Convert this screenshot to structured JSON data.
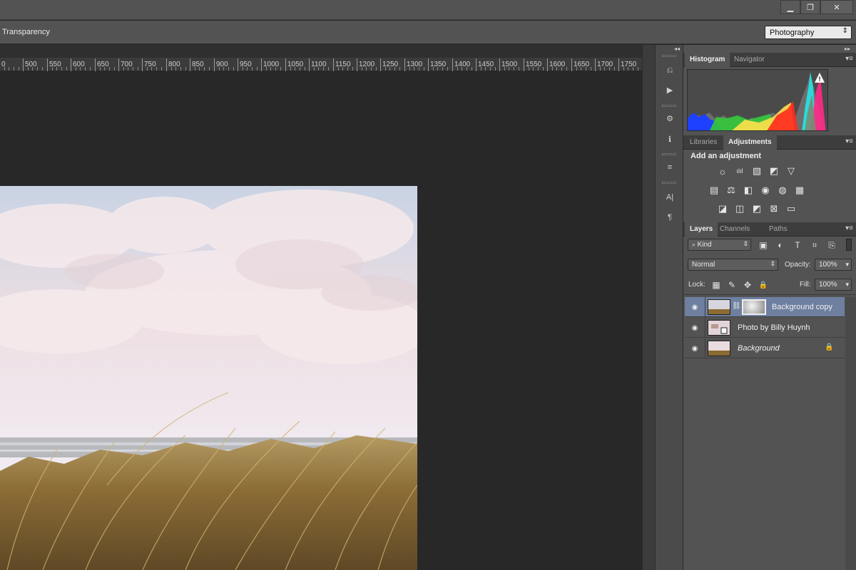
{
  "window": {
    "minimize_glyph": "▁",
    "restore_glyph": "❐",
    "close_glyph": "✕"
  },
  "options": {
    "transparency_label": "Transparency",
    "workspace_value": "Photography",
    "workspace_arrow": "⇕"
  },
  "ruler": {
    "labels": [
      "0",
      "500",
      "550",
      "600",
      "650",
      "700",
      "750",
      "800",
      "850",
      "900",
      "950",
      "1000",
      "1050",
      "1100",
      "1150",
      "1200",
      "1250",
      "1300",
      "1350",
      "1400",
      "1450",
      "1500",
      "1550",
      "1600",
      "1650",
      "1700",
      "1750",
      "18"
    ]
  },
  "collapse_arrows": {
    "dock": "◂◂",
    "panels": "▸▸"
  },
  "panels": {
    "histogram_tabs": [
      "Histogram",
      "Navigator"
    ],
    "histogram_warning": "!",
    "adjust_tabs": [
      "Libraries",
      "Adjustments"
    ],
    "add_adjustment": "Add an adjustment",
    "adjustment_icons": [
      [
        "☼",
        "ılıl",
        "▧",
        "◩",
        "▽"
      ],
      [
        "▤",
        "⚖",
        "◧",
        "◉",
        "◍",
        "▦"
      ],
      [
        "◪",
        "◫",
        "◩",
        "⊠",
        "▭"
      ]
    ],
    "layer_tabs": [
      "Layers",
      "Channels",
      "Paths"
    ],
    "menu_glyph": "▾≡",
    "filter_kind": "Kind",
    "filter_icons": [
      "▣",
      "◐",
      "T",
      "⌗",
      "⎘"
    ],
    "blend_mode": "Normal",
    "opacity_label": "Opacity:",
    "opacity_value": "100%",
    "lock_label": "Lock:",
    "lock_icons": [
      "▦",
      "✎",
      "✥",
      "🔒"
    ],
    "fill_label": "Fill:",
    "fill_value": "100%",
    "layers": [
      {
        "name": "Background copy",
        "selected": true,
        "italic": false,
        "mask": true,
        "locked": false
      },
      {
        "name": "Photo by Billy Huynh",
        "selected": false,
        "italic": false,
        "mask": false,
        "locked": false
      },
      {
        "name": "Background",
        "selected": false,
        "italic": true,
        "mask": false,
        "locked": true
      }
    ],
    "eye_glyph": "◉",
    "lock_glyph": "🔒"
  },
  "dock_icons": [
    "⎌",
    "▶",
    "⚙",
    "ℹ",
    "≡",
    "A|",
    "¶"
  ]
}
